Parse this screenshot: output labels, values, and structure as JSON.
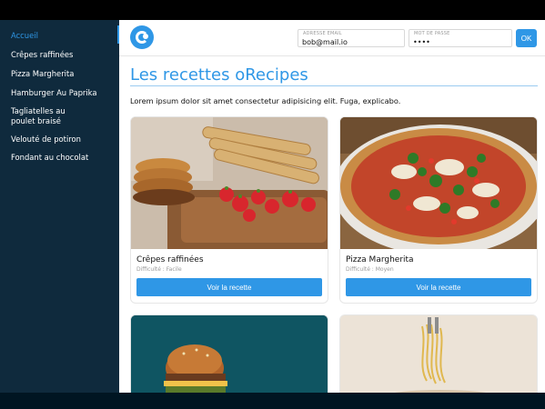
{
  "sidebar": {
    "items": [
      {
        "label": "Accueil",
        "active": true
      },
      {
        "label": "Crêpes raffinées",
        "active": false
      },
      {
        "label": "Pizza Margherita",
        "active": false
      },
      {
        "label": "Hamburger Au Paprika",
        "active": false
      },
      {
        "label": "Tagliatelles au poulet braisé",
        "active": false
      },
      {
        "label": "Velouté de potiron",
        "active": false
      },
      {
        "label": "Fondant au chocolat",
        "active": false
      }
    ]
  },
  "header": {
    "logo_icon": "orecipes-logo-icon",
    "email": {
      "label": "ADRESSE EMAIL",
      "value": "bob@mail.io"
    },
    "password": {
      "label": "MOT DE PASSE",
      "value": "••••"
    },
    "ok_label": "OK"
  },
  "main": {
    "title": "Les recettes oRecipes",
    "intro": "Lorem ipsum dolor sit amet consectetur adipisicing elit. Fuga, explicabo."
  },
  "cards": [
    {
      "title": "Crêpes raffinées",
      "difficulty": "Difficulté : Facile",
      "button": "Voir la recette"
    },
    {
      "title": "Pizza Margherita",
      "difficulty": "Difficulté : Moyen",
      "button": "Voir la recette"
    },
    {
      "title": "",
      "difficulty": "",
      "button": ""
    },
    {
      "title": "",
      "difficulty": "",
      "button": ""
    }
  ],
  "colors": {
    "accent": "#2f97e6",
    "sidebar_bg": "#0f2a3d",
    "active_nav": "#2f97e6"
  }
}
